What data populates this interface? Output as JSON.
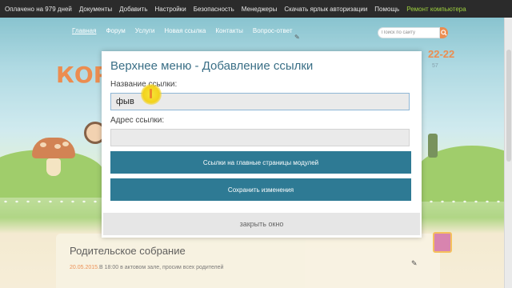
{
  "admin_bar": {
    "items": [
      {
        "label": "Оплачено на 979 дней"
      },
      {
        "label": "Документы"
      },
      {
        "label": "Добавить"
      },
      {
        "label": "Настройки"
      },
      {
        "label": "Безопасность"
      },
      {
        "label": "Менеджеры"
      },
      {
        "label": "Скачать ярлык авторизации"
      },
      {
        "label": "Помощь"
      }
    ],
    "accent_item": "Ремонт компьютера",
    "accent_color": "#9fd23f"
  },
  "site_nav": {
    "items": [
      {
        "label": "Главная"
      },
      {
        "label": "Форум"
      },
      {
        "label": "Услуги"
      },
      {
        "label": "Новая ссылка"
      },
      {
        "label": "Контакты"
      },
      {
        "label": "Вопрос-ответ"
      }
    ],
    "search_placeholder": "Поиск по сайту",
    "search_icon": "search-icon",
    "edit_icon": "pencil-icon"
  },
  "header": {
    "brand_partial": "КОР",
    "phone_partial": "22-22",
    "phone_small": "57"
  },
  "news": {
    "title": "Родительское собрание",
    "date": "20.05.2015.",
    "text": "В 18:00 в актовом зале, просим всех родителей"
  },
  "modal": {
    "title": "Верхнее меню - Добавление ссылки",
    "name_label": "Название ссылки:",
    "name_value": "фыв",
    "url_label": "Адрес ссылки:",
    "url_value": "",
    "modules_button": "Ссылки на главные страницы модулей",
    "save_button": "Сохранить изменения",
    "close_button": "закрыть окно",
    "button_color": "#2e7a94"
  }
}
